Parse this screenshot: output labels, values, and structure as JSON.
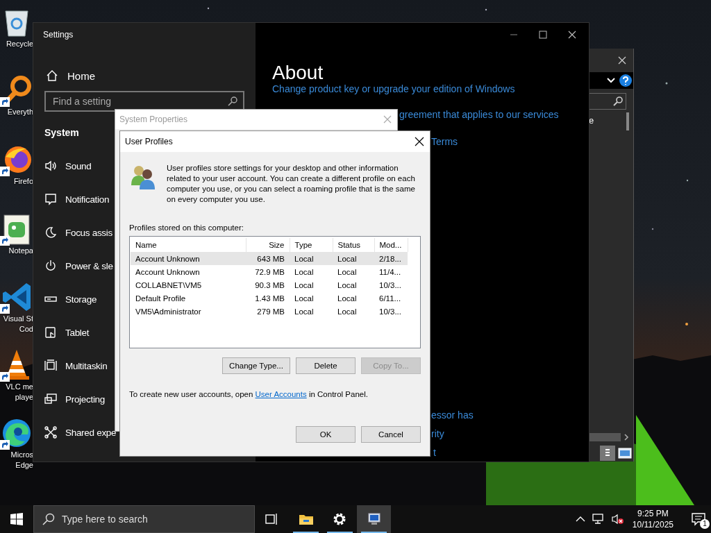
{
  "desktop_icons": [
    {
      "kind": "recycle",
      "lines": [
        "Recycle"
      ],
      "shortcut": false
    },
    {
      "kind": "search",
      "lines": [
        "Everyth"
      ],
      "shortcut": true
    },
    {
      "kind": "browser",
      "lines": [
        "Firefo"
      ],
      "shortcut": true
    },
    {
      "kind": "notepad",
      "lines": [
        "Notepa"
      ],
      "shortcut": true
    },
    {
      "kind": "code",
      "lines": [
        "Visual St",
        "Cod"
      ],
      "shortcut": true
    },
    {
      "kind": "cone",
      "lines": [
        "VLC me",
        "playe"
      ],
      "shortcut": true
    },
    {
      "kind": "edge",
      "lines": [
        "Micros",
        "Edge"
      ],
      "shortcut": true
    }
  ],
  "settings": {
    "title": "Settings",
    "home": "Home",
    "search": {
      "placeholder": "Find a setting"
    },
    "section": "System",
    "nav": [
      {
        "kind": "sound",
        "label": "Sound"
      },
      {
        "kind": "notification",
        "label": "Notification"
      },
      {
        "kind": "focus",
        "label": "Focus assis"
      },
      {
        "kind": "power",
        "label": "Power & sle"
      },
      {
        "kind": "storage",
        "label": "Storage"
      },
      {
        "kind": "tablet",
        "label": "Tablet"
      },
      {
        "kind": "multitasking",
        "label": "Multitaskin"
      },
      {
        "kind": "projecting",
        "label": "Projecting"
      },
      {
        "kind": "shared",
        "label": "Shared expe"
      }
    ],
    "heading": "About",
    "fragments": [
      "Change product key or upgrade your edition of Windows",
      "greement that applies to our services",
      "Terms",
      "essor has",
      "rity",
      "t"
    ]
  },
  "behind_window": {
    "fragment": "e"
  },
  "system_properties": {
    "title": "System Properties"
  },
  "user_profiles": {
    "title": "User Profiles",
    "description": "User profiles store settings for your desktop and other information related to your user account. You can create a different profile on each computer you use, or you can select a roaming profile that is the same on every computer you use.",
    "list_label": "Profiles stored on this computer:",
    "columns": [
      "Name",
      "Size",
      "Type",
      "Status",
      "Mod..."
    ],
    "rows": [
      {
        "cells": [
          "Account Unknown",
          "643 MB",
          "Local",
          "Local",
          "2/18..."
        ],
        "selected": true
      },
      {
        "cells": [
          "Account Unknown",
          "72.9 MB",
          "Local",
          "Local",
          "11/4..."
        ],
        "selected": false
      },
      {
        "cells": [
          "COLLABNET\\VM5",
          "90.3 MB",
          "Local",
          "Local",
          "10/3..."
        ],
        "selected": false
      },
      {
        "cells": [
          "Default Profile",
          "1.43 MB",
          "Local",
          "Local",
          "6/11..."
        ],
        "selected": false
      },
      {
        "cells": [
          "VM5\\Administrator",
          "279 MB",
          "Local",
          "Local",
          "10/3..."
        ],
        "selected": false
      }
    ],
    "buttons": [
      {
        "label": "Change Type...",
        "disabled": false
      },
      {
        "label": "Delete",
        "disabled": false
      },
      {
        "label": "Copy To...",
        "disabled": true
      }
    ],
    "footer": {
      "before": "To create new user accounts, open",
      "link": "User Accounts",
      "after": "in Control Panel."
    },
    "dialog_buttons": [
      {
        "label": "OK"
      },
      {
        "label": "Cancel"
      }
    ]
  },
  "taskbar": {
    "search": {
      "placeholder": "Type here to search"
    },
    "apps": [
      {
        "kind": "task-view",
        "running": false,
        "active": false
      },
      {
        "kind": "folder",
        "running": true,
        "active": false
      },
      {
        "kind": "gear",
        "running": true,
        "active": false
      },
      {
        "kind": "system",
        "running": true,
        "active": true
      }
    ],
    "time": "9:25 PM",
    "date": "10/11/2025",
    "notifications": "1"
  }
}
